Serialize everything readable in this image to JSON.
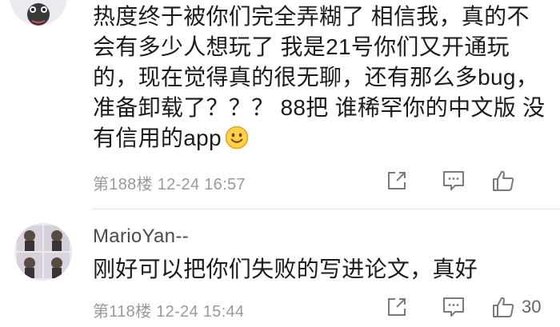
{
  "comments": [
    {
      "text": "热度终于被你们完全弄糊了 相信我，真的不会有多少人想玩了 我是21号你们又开通玩的，现在觉得真的很无聊，还有那么多bug，准备卸载了？？？ 88把 谁稀罕你的中文版 没有信用的app",
      "emoji": "smiley-emoji",
      "floor": "第188楼",
      "time": "12-24 16:57"
    },
    {
      "username": "MarioYan--",
      "text": "刚好可以把你们失败的写进论文，真好",
      "floor": "第118楼",
      "time": "12-24 15:44",
      "likes": "30"
    }
  ],
  "icons": [
    "share-icon",
    "reply-icon",
    "like-icon"
  ],
  "colors": {
    "text": "#1b1b1b",
    "meta": "#9a9a9a",
    "icon": "#7a7a7a",
    "divider": "#e3e3e3"
  }
}
